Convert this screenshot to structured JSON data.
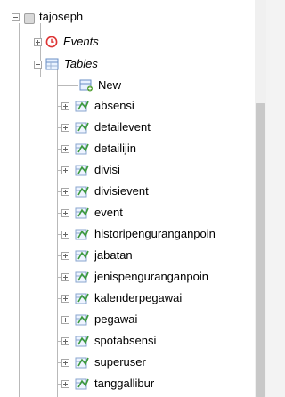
{
  "tree": {
    "database": {
      "name": "tajoseph",
      "icon": "database-icon"
    },
    "events": {
      "label": "Events",
      "icon": "clock-icon"
    },
    "tables": {
      "label": "Tables",
      "icon": "table-folder-icon"
    },
    "new": {
      "label": "New",
      "icon": "new-table-icon"
    },
    "table_items": [
      "absensi",
      "detailevent",
      "detailijin",
      "divisi",
      "divisievent",
      "event",
      "historipenguranganpoin",
      "jabatan",
      "jenispenguranganpoin",
      "kalenderpegawai",
      "pegawai",
      "spotabsensi",
      "superuser",
      "tanggallibur"
    ]
  }
}
